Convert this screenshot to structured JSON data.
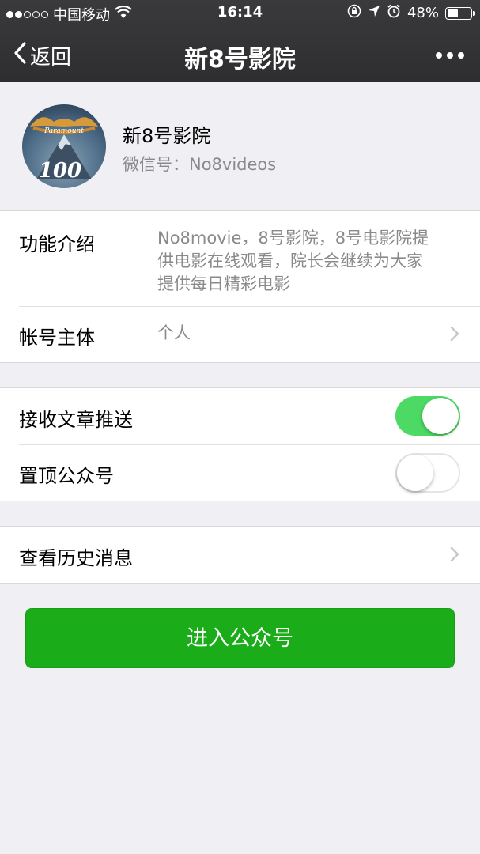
{
  "status_bar": {
    "carrier": "中国移动",
    "time": "16:14",
    "battery_percent": "48%",
    "battery_level": 0.48,
    "signal_dots_filled": 2,
    "signal_dots_total": 5,
    "icons": [
      "wifi-icon",
      "rotation-lock-icon",
      "location-icon",
      "alarm-icon",
      "battery-icon"
    ]
  },
  "navbar": {
    "back_label": "返回",
    "title": "新8号影院",
    "more_icon": "more-dots-icon"
  },
  "profile": {
    "name": "新8号影院",
    "wechat_id": "微信号：No8videos",
    "avatar_text": [
      "Paramount",
      "100"
    ]
  },
  "info": {
    "intro_label": "功能介绍",
    "intro_lines": [
      "No8movie，8号影院，8号电影院提",
      "供电影在线观看，院长会继续为大家",
      "提供每日精彩电影"
    ],
    "account_label": "帐号主体",
    "account_value": "个人"
  },
  "settings": {
    "receive_label": "接收文章推送",
    "receive_on": true,
    "pin_label": "置顶公众号",
    "pin_on": false
  },
  "history": {
    "label": "查看历史消息"
  },
  "enter_button": {
    "label": "进入公众号"
  },
  "colors": {
    "navbar": "#2e2e30",
    "background": "#efeff4",
    "toggle_on": "#4cd964",
    "primary_button": "#1aad19"
  }
}
